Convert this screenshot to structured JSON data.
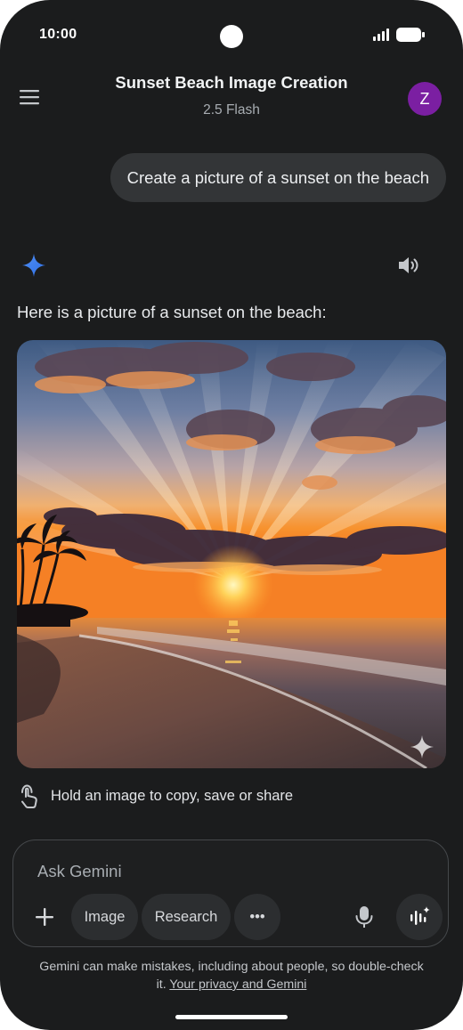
{
  "status_bar": {
    "time": "10:00"
  },
  "header": {
    "title": "Sunset Beach Image Creation",
    "model": "2.5 Flash",
    "avatar_initial": "Z",
    "avatar_color": "#7b1fa2"
  },
  "conversation": {
    "user_message": "Create a picture of a sunset on the beach",
    "response_text": "Here is a picture of a sunset on the beach:",
    "image_hint": "Hold an image to copy, save or share"
  },
  "composer": {
    "placeholder": "Ask Gemini",
    "chips": [
      "Image",
      "Research"
    ],
    "more_label": "•••"
  },
  "footer": {
    "disclaimer": "Gemini can make mistakes, including about people, so double-check it.",
    "privacy_link": "Your privacy and Gemini"
  },
  "colors": {
    "background": "#1b1c1d",
    "bubble": "#333537",
    "accent_spark": "#4285f4"
  }
}
